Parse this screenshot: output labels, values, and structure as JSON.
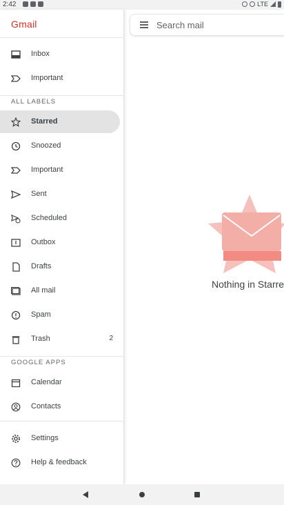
{
  "status_bar": {
    "time": "2:42",
    "network": "LTE"
  },
  "app": {
    "brand": "Gmail"
  },
  "search": {
    "placeholder": "Search mail"
  },
  "empty_state": {
    "message": "Nothing in Starre"
  },
  "drawer": {
    "top_items": [
      {
        "label": "Inbox",
        "icon": "inbox-icon"
      },
      {
        "label": "Important",
        "icon": "important-icon"
      }
    ],
    "labels_header": "ALL LABELS",
    "label_items": [
      {
        "label": "Starred",
        "icon": "star-icon",
        "selected": true
      },
      {
        "label": "Snoozed",
        "icon": "clock-icon"
      },
      {
        "label": "Important",
        "icon": "important-icon"
      },
      {
        "label": "Sent",
        "icon": "send-icon"
      },
      {
        "label": "Scheduled",
        "icon": "scheduled-icon"
      },
      {
        "label": "Outbox",
        "icon": "outbox-icon"
      },
      {
        "label": "Drafts",
        "icon": "draft-icon"
      },
      {
        "label": "All mail",
        "icon": "all-mail-icon"
      },
      {
        "label": "Spam",
        "icon": "spam-icon"
      },
      {
        "label": "Trash",
        "icon": "trash-icon",
        "count": "2"
      }
    ],
    "apps_header": "GOOGLE APPS",
    "app_items": [
      {
        "label": "Calendar",
        "icon": "calendar-icon"
      },
      {
        "label": "Contacts",
        "icon": "contacts-icon"
      }
    ],
    "footer_items": [
      {
        "label": "Settings",
        "icon": "gear-icon"
      },
      {
        "label": "Help & feedback",
        "icon": "help-icon"
      }
    ]
  },
  "colors": {
    "brand_red": "#d93025",
    "selected_bg": "#e3e3e3",
    "illustration_red": "#f28b82"
  }
}
